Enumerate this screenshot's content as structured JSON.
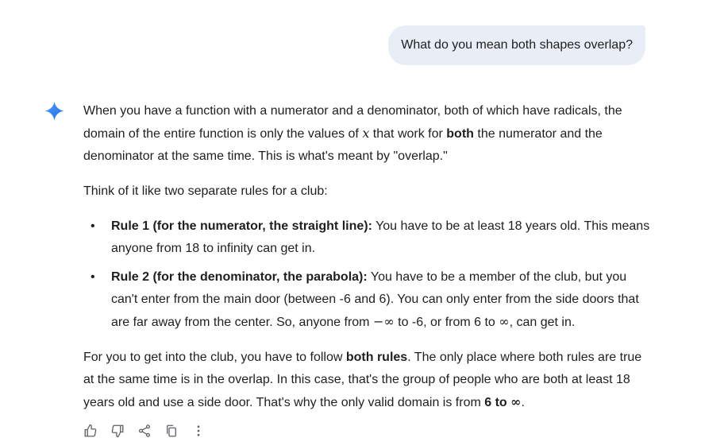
{
  "user_message": {
    "text": "What do you mean both shapes overlap?"
  },
  "response": {
    "p1": {
      "a": "When you have a function with a numerator and a denominator, both of which have radicals, the domain of the entire function is only the values of ",
      "var": "x",
      "b": " that work for ",
      "bold": "both",
      "c": " the numerator and the denominator at the same time. This is what's meant by \"overlap.\""
    },
    "p2": "Think of it like two separate rules for a club:",
    "bullet_glyph": "•",
    "rule1": {
      "title": "Rule 1 (for the numerator, the straight line):",
      "text": " You have to be at least 18 years old. This means anyone from 18 to infinity can get in."
    },
    "rule2": {
      "title": "Rule 2 (for the denominator, the parabola):",
      "a": " You have to be a member of the club, but you can't enter from the main door (between -6 and 6). You can only enter from the side doors that are far away from the center. So, anyone from ",
      "neg_inf": "−∞",
      "b": " to -6, or from 6 to ",
      "inf": "∞",
      "c": ", can get in."
    },
    "p3": {
      "a": "For you to get into the club, you have to follow ",
      "bold1": "both rules",
      "b": ". The only place where both rules are true at the same time is in the overlap. In this case, that's the group of people who are both at least 18 years old and use a side door. That's why the only valid domain is from ",
      "bold2": "6 to ",
      "inf": "∞",
      "c": "."
    }
  },
  "actions": {
    "icons": [
      "thumb-up-icon",
      "thumb-down-icon",
      "share-icon",
      "copy-icon",
      "more-options-icon"
    ]
  },
  "colors": {
    "user_bubble_bg": "#e9eef6",
    "text": "#1f1f1f",
    "spark_gradient": [
      "#4f8df6",
      "#1a6cf0"
    ],
    "icon": "#5f6368"
  }
}
